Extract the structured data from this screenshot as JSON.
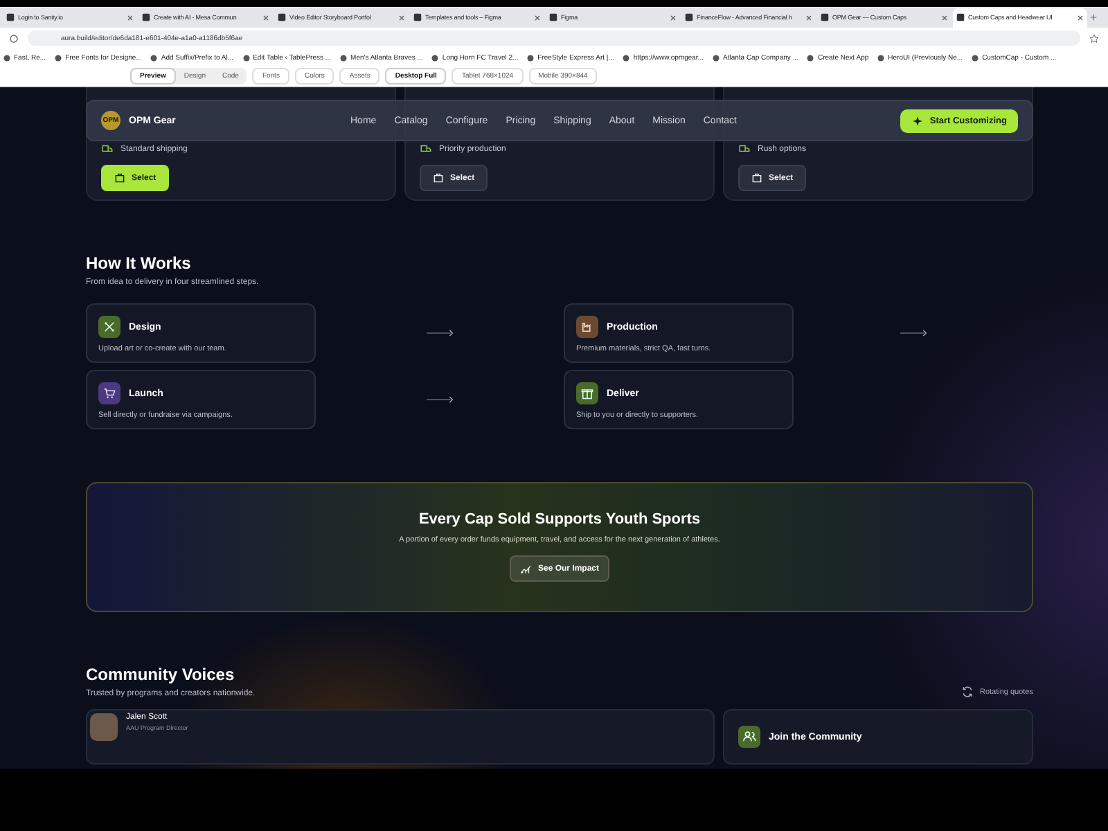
{
  "browser": {
    "tabs": [
      {
        "title": "Login to Sanity.io",
        "selected": false
      },
      {
        "title": "Create with AI - Mesa Commun",
        "selected": false
      },
      {
        "title": "Video Editor Storyboard Portfol",
        "selected": false
      },
      {
        "title": "Templates and tools – Figma",
        "selected": false
      },
      {
        "title": "Figma",
        "selected": false
      },
      {
        "title": "FinanceFlow - Advanced Financial h",
        "selected": false
      },
      {
        "title": "OPM Gear — Custom Caps",
        "selected": false
      },
      {
        "title": "Custom Caps and Headwear UI",
        "selected": true
      }
    ],
    "url": "aura.build/editor/de6da181-e601-404e-a1a0-a1186db5f6ae",
    "bookmarks": [
      "Fast, Re...",
      "Free Fonts for Designe...",
      "Add Suffix/Prefix to Al...",
      "Edit Table ‹ TablePress ...",
      "Men's Atlanta Braves ...",
      "Long Horn FC Travel 2...",
      "FreeStyle Express Art |...",
      "https://www.opmgear...",
      "Atlanta Cap Company ...",
      "Create Next App",
      "HeroUI (Previously Ne...",
      "CustomCap - Custom ..."
    ]
  },
  "editor_toolbar": {
    "modes": [
      {
        "label": "Preview",
        "selected": true
      },
      {
        "label": "Design",
        "selected": false
      },
      {
        "label": "Code",
        "selected": false
      }
    ],
    "tools": [
      "Fonts",
      "Colors",
      "Assets"
    ],
    "devices": [
      {
        "label": "Desktop Full",
        "selected": true
      },
      {
        "label": "Tablet 768×1024",
        "selected": false
      },
      {
        "label": "Mobile 390×844",
        "selected": false
      }
    ]
  },
  "pricing_cards": [
    {
      "feature": "Standard shipping",
      "button": "Select",
      "selected": true
    },
    {
      "feature": "Priority production",
      "button": "Select",
      "selected": false
    },
    {
      "feature": "Rush options",
      "button": "Select",
      "selected": false
    }
  ],
  "nav": {
    "logo": "OPM",
    "brand": "OPM Gear",
    "links": [
      "Home",
      "Catalog",
      "Configure",
      "Pricing",
      "Shipping",
      "About",
      "Mission",
      "Contact"
    ],
    "cta": "Start Customizing"
  },
  "how_it_works": {
    "title": "How It Works",
    "subtitle": "From idea to delivery in four streamlined steps.",
    "steps": [
      {
        "kind": "design",
        "title": "Design",
        "description": "Upload art or co-create with our team.",
        "color": "#4a6a2a",
        "arrow": true
      },
      {
        "kind": "production",
        "title": "Production",
        "description": "Premium materials, strict QA, fast turns.",
        "color": "#6b4a30",
        "arrow": true
      },
      {
        "kind": "launch",
        "title": "Launch",
        "description": "Sell directly or fundraise via campaigns.",
        "color": "#4c3a80",
        "arrow": true
      },
      {
        "kind": "deliver",
        "title": "Deliver",
        "description": "Ship to you or directly to supporters.",
        "color": "#4a6a2a",
        "arrow": false
      }
    ]
  },
  "impact": {
    "title": "Every Cap Sold Supports Youth Sports",
    "text": "A portion of every order funds equipment, travel, and access for the next generation of athletes.",
    "button": "See Our Impact"
  },
  "community": {
    "title": "Community Voices",
    "subtitle": "Trusted by programs and creators nationwide.",
    "rotating": "Rotating quotes",
    "testimonial": {
      "name": "Jalen Scott",
      "role": "AAU Program Director"
    },
    "join": "Join the Community"
  }
}
